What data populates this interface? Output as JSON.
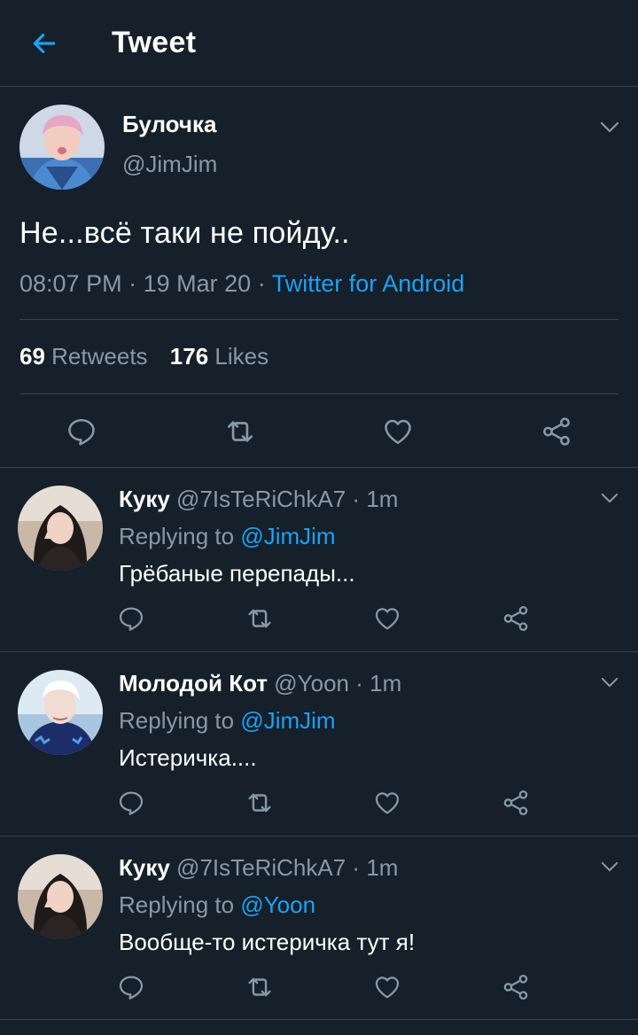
{
  "header": {
    "title": "Tweet"
  },
  "main_tweet": {
    "author_name": "Булочка",
    "author_handle": "@JimJim",
    "text": "Не...всё таки не пойду..",
    "time": "08:07 PM",
    "date": "19 Mar 20",
    "source": "Twitter for Android",
    "retweets_count": "69",
    "retweets_label": "Retweets",
    "likes_count": "176",
    "likes_label": "Likes"
  },
  "replies": [
    {
      "name": "Куку",
      "handle": "@7IsTeRiChkA7",
      "time": "1m",
      "replying_label": "Replying to",
      "replying_to": "@JimJim",
      "text": "Грёбаные перепады..."
    },
    {
      "name": "Молодой Кот",
      "handle": "@Yoon",
      "time": "1m",
      "replying_label": "Replying to",
      "replying_to": "@JimJim",
      "text": "Истеричка...."
    },
    {
      "name": "Куку",
      "handle": "@7IsTeRiChkA7",
      "time": "1m",
      "replying_label": "Replying to",
      "replying_to": "@Yoon",
      "text": "Вообще-то истеричка тут я!"
    }
  ],
  "separator": "·",
  "icons": {
    "back": "arrow-left-icon",
    "caret": "chevron-down-icon",
    "reply": "speech-bubble-icon",
    "retweet": "retweet-icon",
    "like": "heart-icon",
    "share": "share-icon"
  },
  "colors": {
    "background": "#15202b",
    "accent": "#1da1f2",
    "muted": "#8899a6",
    "divider": "#38444d"
  }
}
